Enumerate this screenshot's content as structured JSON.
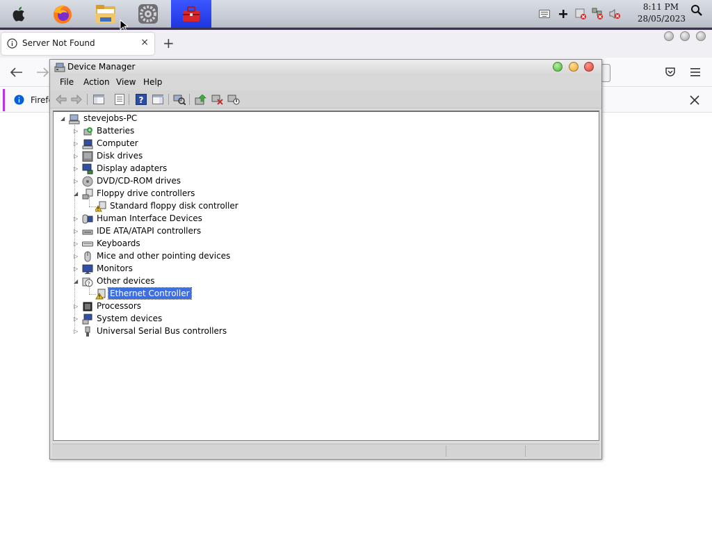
{
  "taskbar": {
    "apps": [
      {
        "name": "Apple menu",
        "icon": "apple-icon"
      },
      {
        "name": "Firefox",
        "icon": "firefox-icon"
      },
      {
        "name": "File Manager",
        "icon": "folder-icon"
      },
      {
        "name": "System Settings",
        "icon": "settings-icon"
      },
      {
        "name": "Toolbox",
        "icon": "toolbox-icon",
        "active": true
      }
    ],
    "tray_icons": [
      "keyboard-icon",
      "plus-icon",
      "printer-error-icon",
      "network-error-icon",
      "volume-muted-icon",
      "search-icon"
    ],
    "clock_time": "8:11 PM",
    "clock_date": "28/05/2023"
  },
  "firefox": {
    "tab_title": "Server Not Found",
    "tab_close": "×",
    "new_tab": "+",
    "infobar_text": "Firefo"
  },
  "device_manager": {
    "title": "Device Manager",
    "menu": [
      "File",
      "Action",
      "View",
      "Help"
    ],
    "tree": {
      "root": "stevejobs-PC",
      "categories": [
        {
          "label": "Batteries",
          "expanded": false
        },
        {
          "label": "Computer",
          "expanded": false
        },
        {
          "label": "Disk drives",
          "expanded": false
        },
        {
          "label": "Display adapters",
          "expanded": false
        },
        {
          "label": "DVD/CD-ROM drives",
          "expanded": false
        },
        {
          "label": "Floppy drive controllers",
          "expanded": true,
          "children": [
            {
              "label": "Standard floppy disk controller",
              "warning": true
            }
          ]
        },
        {
          "label": "Human Interface Devices",
          "expanded": false
        },
        {
          "label": "IDE ATA/ATAPI controllers",
          "expanded": false
        },
        {
          "label": "Keyboards",
          "expanded": false
        },
        {
          "label": "Mice and other pointing devices",
          "expanded": false
        },
        {
          "label": "Monitors",
          "expanded": false
        },
        {
          "label": "Other devices",
          "expanded": true,
          "children": [
            {
              "label": "Ethernet Controller",
              "warning": true,
              "selected": true
            }
          ]
        },
        {
          "label": "Processors",
          "expanded": false
        },
        {
          "label": "System devices",
          "expanded": false
        },
        {
          "label": "Universal Serial Bus controllers",
          "expanded": false
        }
      ]
    }
  },
  "colors": {
    "selection": "#3f6ee0",
    "active_app": "#2a45f0",
    "window_close": "#e03a2f",
    "window_minimize": "#f0a020",
    "window_maximize": "#42b52e"
  }
}
